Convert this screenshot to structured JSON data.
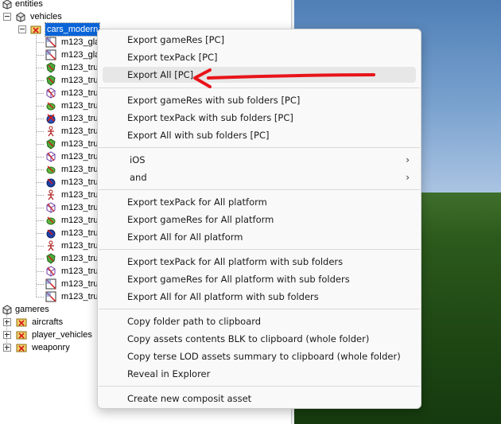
{
  "tree": {
    "entities": "entities",
    "vehicles": "vehicles",
    "cars_modern": "cars_modern",
    "items": [
      {
        "label": "m123_gla",
        "icon": "texture-icon"
      },
      {
        "label": "m123_gla",
        "icon": "texture-icon"
      },
      {
        "label": "m123_tru",
        "icon": "green-shield-icon"
      },
      {
        "label": "m123_tru",
        "icon": "green-shield-icon"
      },
      {
        "label": "m123_tru",
        "icon": "lod-cube-icon"
      },
      {
        "label": "m123_tru",
        "icon": "green-fish-icon"
      },
      {
        "label": "m123_tru",
        "icon": "red-x-icon"
      },
      {
        "label": "m123_tru",
        "icon": "skeleton-icon"
      },
      {
        "label": "m123_tru",
        "icon": "green-shield-icon"
      },
      {
        "label": "m123_tru",
        "icon": "lod-cube-icon"
      },
      {
        "label": "m123_tru",
        "icon": "green-fish-icon"
      },
      {
        "label": "m123_tru",
        "icon": "blue-sphere-icon"
      },
      {
        "label": "m123_tru",
        "icon": "skeleton-icon"
      },
      {
        "label": "m123_tru",
        "icon": "lod-cube-icon"
      },
      {
        "label": "m123_tru",
        "icon": "green-fish-icon"
      },
      {
        "label": "m123_tru",
        "icon": "blue-sphere-icon"
      },
      {
        "label": "m123_tru",
        "icon": "skeleton-icon"
      },
      {
        "label": "m123_tru",
        "icon": "green-shield-icon"
      },
      {
        "label": "m123_tru",
        "icon": "lod-cube-icon"
      },
      {
        "label": "m123_tru",
        "icon": "texture-icon"
      },
      {
        "label": "m123_tru",
        "icon": "texture-icon"
      }
    ],
    "gameres": "gameres",
    "aircrafts": "aircrafts",
    "player_vehicles": "player_vehicles",
    "weaponry": "weaponry"
  },
  "menu": {
    "export_gameres_pc": "Export gameRes [PC]",
    "export_texpack_pc": "Export texPack [PC]",
    "export_all_pc": "Export All [PC]",
    "export_gameres_sub_pc": "Export gameRes with sub folders [PC]",
    "export_texpack_sub_pc": "Export texPack with sub folders [PC]",
    "export_all_sub_pc": "Export All with sub folders [PC]",
    "ios": "iOS",
    "and": "and",
    "export_texpack_all_platform": "Export texPack for All platform",
    "export_gameres_all_platform": "Export gameRes for All platform",
    "export_all_all_platform": "Export All for All platform",
    "export_texpack_all_platform_sub": "Export texPack for All platform with sub folders",
    "export_gameres_all_platform_sub": "Export gameRes for All platform with sub folders",
    "export_all_all_platform_sub": "Export All for All platform with sub folders",
    "copy_folder_path": "Copy folder path to clipboard",
    "copy_assets_blk": "Copy assets contents BLK to clipboard (whole folder)",
    "copy_terse_lod": "Copy terse LOD assets summary to clipboard (whole folder)",
    "reveal_explorer": "Reveal in Explorer",
    "create_composit": "Create new composit asset",
    "submenu_chevron": "›",
    "highlighted_item": "Export All [PC]"
  },
  "colors": {
    "selection": "#0a64d8",
    "annotation_arrow": "#e8141a",
    "menu_bg": "#f9f9f9",
    "menu_highlight": "#e7e7e7"
  }
}
